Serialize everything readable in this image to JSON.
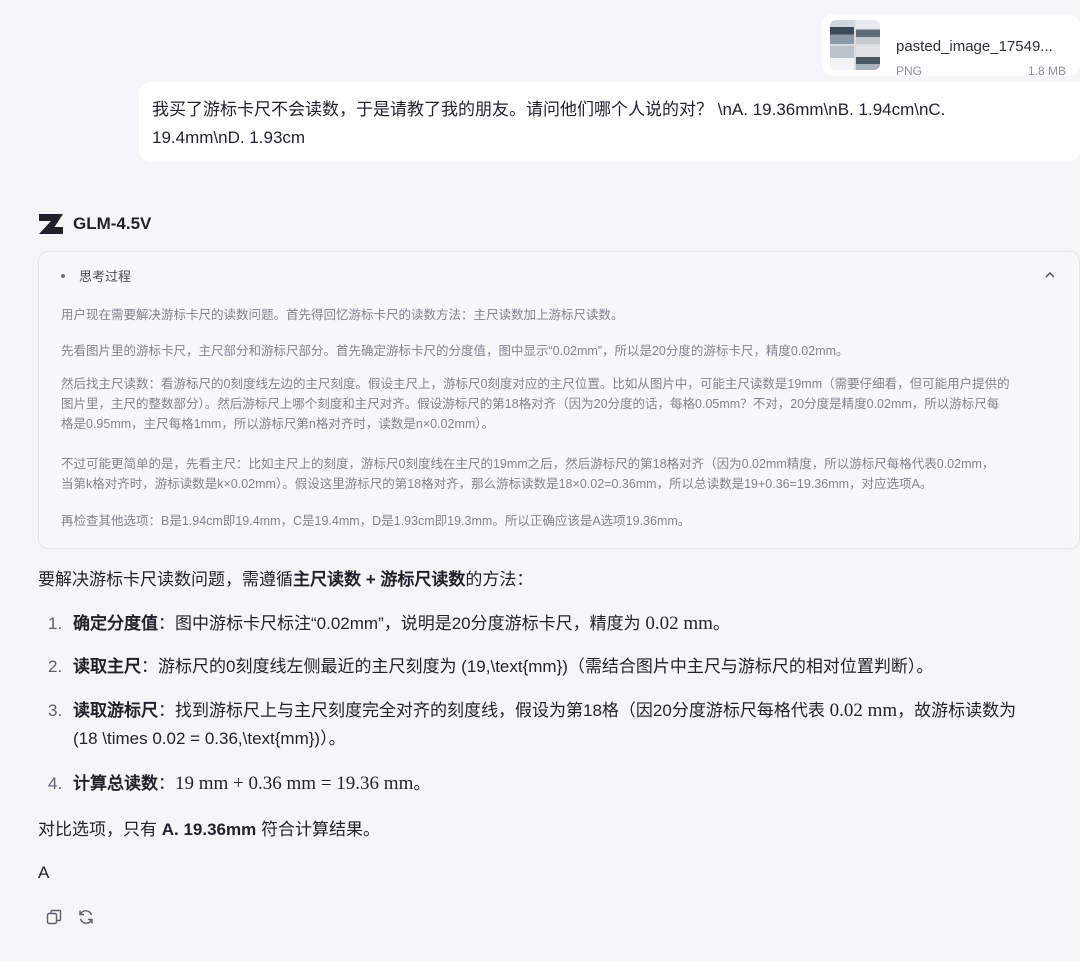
{
  "attachment": {
    "file_name": "pasted_image_17549...",
    "file_type": "PNG",
    "file_size": "1.8 MB"
  },
  "user_message": {
    "line1": "我买了游标卡尺不会读数，于是请教了我的朋友。请问他们哪个人说的对？ \\nA. 19.36mm\\nB. 1.94cm\\nC.",
    "line2": "19.4mm\\nD. 1.93cm"
  },
  "model": {
    "name": "GLM-4.5V",
    "logo_icon": "zhipu-logo-icon"
  },
  "thinking": {
    "title": "思考过程",
    "expanded": true,
    "paragraphs": [
      [
        "用户现在需要解决游标卡尺的读数问题。首先得回忆游标卡尺的读数方法：主尺读数加上游标尺读数。"
      ],
      [
        "先看图片里的游标卡尺，主尺部分和游标尺部分。首先确定游标卡尺的分度值，图中显示“0.02mm”，所以是20分度的游标卡尺，精度0.02mm。"
      ],
      [
        "然后找主尺读数：看游标尺的0刻度线左边的主尺刻度。假设主尺上，游标尺0刻度对应的主尺位置。比如从图片中，可能主尺读数是19mm（需要仔细看，但可能用户提供的",
        "图片里，主尺的整数部分）。然后游标尺上哪个刻度和主尺对齐。假设游标尺的第18格对齐（因为20分度的话，每格0.05mm？不对，20分度是精度0.02mm，所以游标尺每",
        "格是0.95mm，主尺每格1mm，所以游标尺第n格对齐时，读数是n×0.02mm）。"
      ],
      [
        "不过可能更简单的是，先看主尺：比如主尺上的刻度，游标尺0刻度线在主尺的19mm之后，然后游标尺的第18格对齐（因为0.02mm精度，所以游标尺每格代表0.02mm，",
        "当第k格对齐时，游标读数是k×0.02mm）。假设这里游标尺的第18格对齐，那么游标读数是18×0.02=0.36mm，所以总读数是19+0.36=19.36mm，对应选项A。"
      ],
      [
        "再检查其他选项：B是1.94cm即19.4mm，C是19.4mm，D是1.93cm即19.3mm。所以正确应该是A选项19.36mm。"
      ]
    ]
  },
  "answer": {
    "intro_prefix": "要解决游标卡尺读数问题，需遵循",
    "intro_bold": "主尺读数 + 游标尺读数",
    "intro_suffix": "的方法：",
    "items": [
      {
        "num": "1.",
        "bold": "确定分度值",
        "text": "：图中游标卡尺标注“0.02mm”，说明是20分度游标卡尺，精度为",
        "math": " 0.02 mm",
        "tail": "。"
      },
      {
        "num": "2.",
        "bold": "读取主尺",
        "text": "：游标尺的0刻度线左侧最近的主尺刻度为 (19,\\text{mm})（需结合图片中主尺与游标尺的相对位置判断）。"
      },
      {
        "num": "3.",
        "bold": "读取游标尺",
        "text": "：找到游标尺上与主尺刻度完全对齐的刻度线，假设为第18格（因20分度游标尺每格代表",
        "math": " 0.02 mm",
        "tail": "，故游标读数为",
        "line2": "(18 \\times 0.02 = 0.36,\\text{mm})）。"
      },
      {
        "num": "4.",
        "bold": "计算总读数",
        "text": "：",
        "math": "19 mm + 0.36 mm = 19.36 mm",
        "tail": "。"
      }
    ],
    "conclusion_prefix": "对比选项，只有 ",
    "conclusion_bold": "A. 19.36mm",
    "conclusion_suffix": " 符合计算结果。",
    "final": "A"
  },
  "actions": {
    "copy_icon": "copy-icon",
    "regenerate_icon": "refresh-icon"
  }
}
